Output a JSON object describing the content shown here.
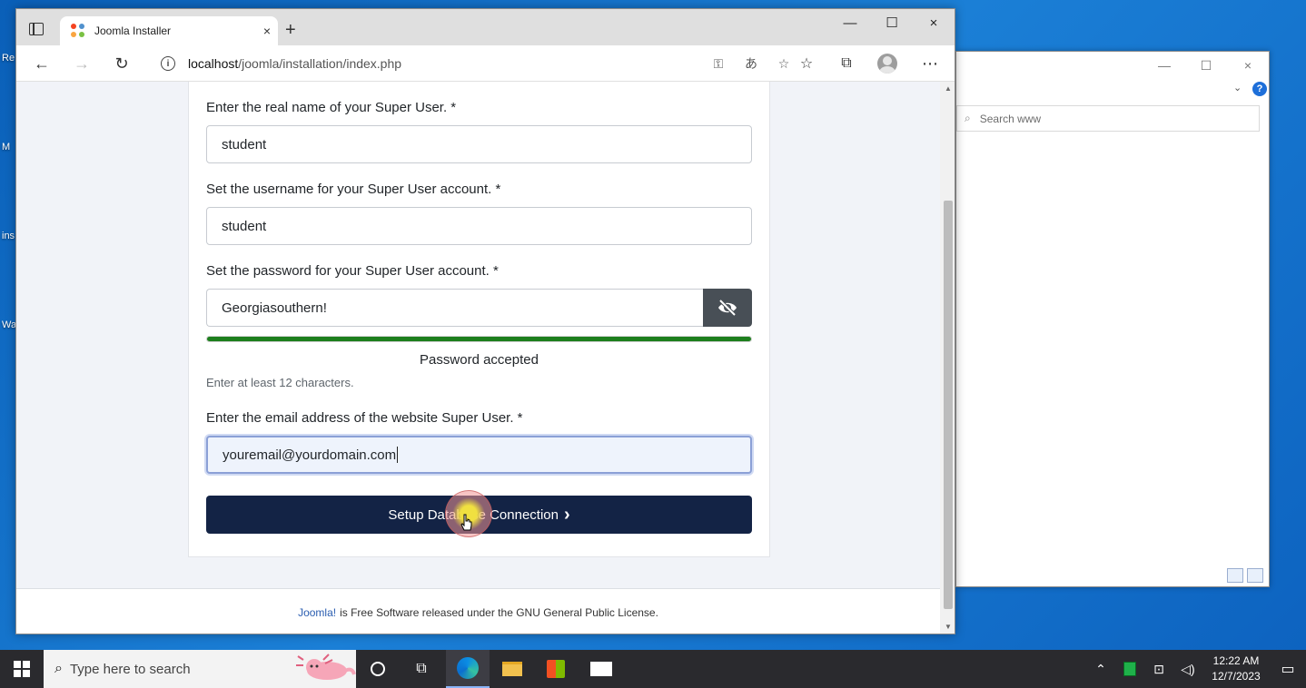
{
  "browser": {
    "tab_title": "Joomla Installer",
    "url_host": "localhost",
    "url_path": "/joomla/installation/index.php"
  },
  "form": {
    "realname_label": "Enter the real name of your Super User. *",
    "realname_value": "student",
    "username_label": "Set the username for your Super User account. *",
    "username_value": "student",
    "password_label": "Set the password for your Super User account. *",
    "password_value": "Georgiasouthern!",
    "password_strength": 1.0,
    "password_status": "Password accepted",
    "password_hint": "Enter at least 12 characters.",
    "email_label": "Enter the email address of the website Super User. *",
    "email_value": "youremail@yourdomain.com",
    "submit_label": "Setup Database Connection"
  },
  "footer": {
    "link_text": "Joomla!",
    "text": "is Free Software released under the GNU General Public License."
  },
  "explorer": {
    "search_placeholder": "Search www"
  },
  "taskbar": {
    "search_placeholder": "Type here to search",
    "time": "12:22 AM",
    "date": "12/7/2023"
  },
  "desktop": {
    "fragments": [
      "Re",
      "M",
      "ins",
      "Wa"
    ]
  },
  "colors": {
    "submit_bg": "#132345",
    "meter_fill": "#1d7f1d",
    "link": "#2a5db0"
  },
  "icons": {
    "close": "×",
    "new_tab": "+",
    "minimize": "—",
    "maximize": "☐",
    "back": "←",
    "forward": "→",
    "refresh": "↻",
    "more": "⋯",
    "chevron_right": "›",
    "chevron_down": "⌄",
    "help": "?",
    "search": "⌕"
  }
}
